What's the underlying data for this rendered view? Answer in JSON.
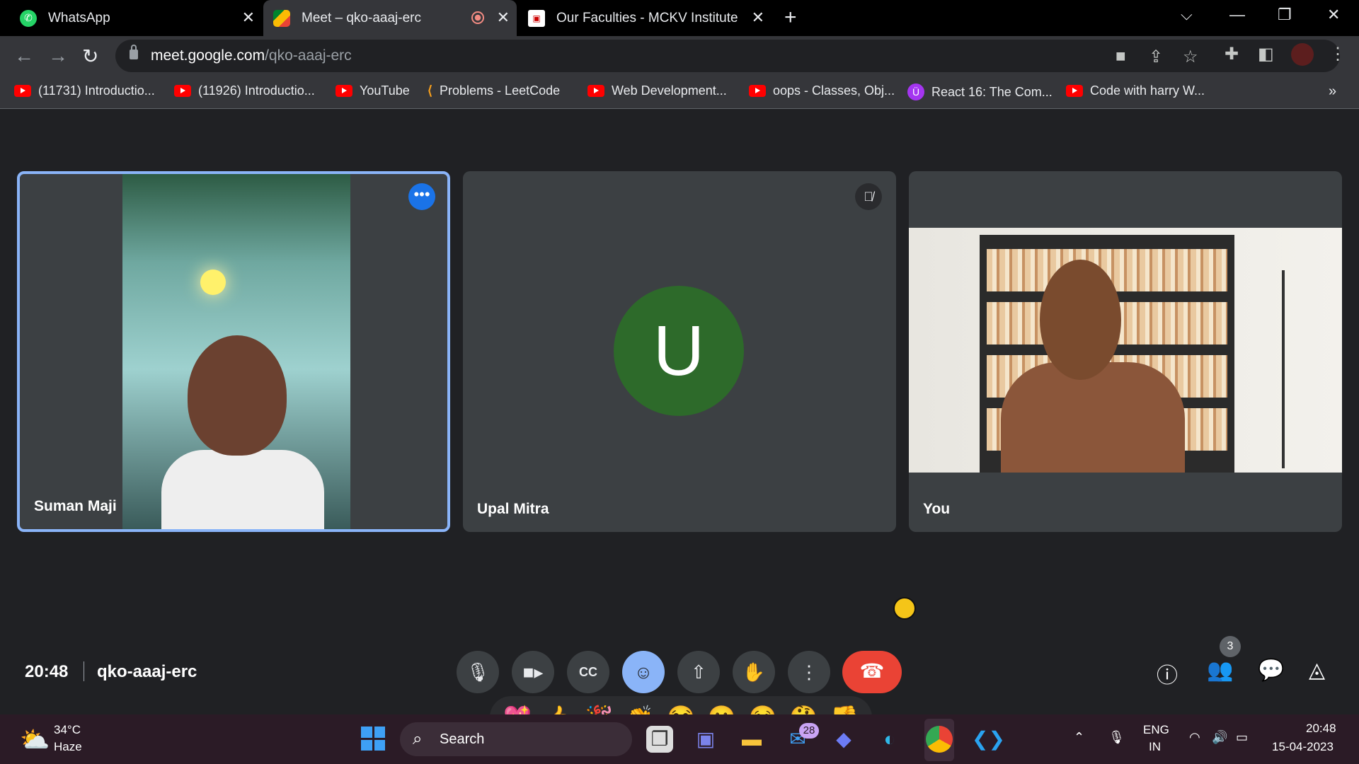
{
  "tabs": [
    {
      "title": "WhatsApp",
      "icon": "whatsapp-icon"
    },
    {
      "title": "Meet – qko-aaaj-erc",
      "icon": "google-meet-icon",
      "active": true
    },
    {
      "title": "Our Faculties - MCKV Institute of",
      "icon": "mckv-logo-icon"
    }
  ],
  "address": {
    "domain": "meet.google.com",
    "path": "/qko-aaaj-erc"
  },
  "bookmarks": [
    {
      "label": "(11731) Introductio...",
      "icon": "youtube-icon"
    },
    {
      "label": "(11926) Introductio...",
      "icon": "youtube-icon"
    },
    {
      "label": "YouTube",
      "icon": "youtube-icon"
    },
    {
      "label": "Problems - LeetCode",
      "icon": "leetcode-icon"
    },
    {
      "label": "Web Development...",
      "icon": "youtube-icon"
    },
    {
      "label": "oops - Classes, Obj...",
      "icon": "youtube-icon"
    },
    {
      "label": "React 16: The Com...",
      "icon": "udemy-icon"
    },
    {
      "label": "Code with harry  W...",
      "icon": "youtube-icon"
    }
  ],
  "participants": [
    {
      "name": "Suman Maji",
      "speaking": true
    },
    {
      "name": "Upal Mitra",
      "initial": "U",
      "muted": true
    },
    {
      "name": "You"
    }
  ],
  "reactions": [
    "💖",
    "👍",
    "🎉",
    "👏",
    "😂",
    "😮",
    "😢",
    "🤔",
    "👎"
  ],
  "meeting": {
    "time": "20:48",
    "code": "qko-aaaj-erc"
  },
  "people_count": "3",
  "colors": {
    "end_call": "#ea4335",
    "active_border": "#8ab4f8",
    "avatar_bg": "#2d6a2a"
  },
  "taskbar": {
    "temp": "34°C",
    "condition": "Haze",
    "search": "Search",
    "mail_badge": "28",
    "lang_line1": "ENG",
    "lang_line2": "IN",
    "time": "20:48",
    "date": "15-04-2023"
  }
}
